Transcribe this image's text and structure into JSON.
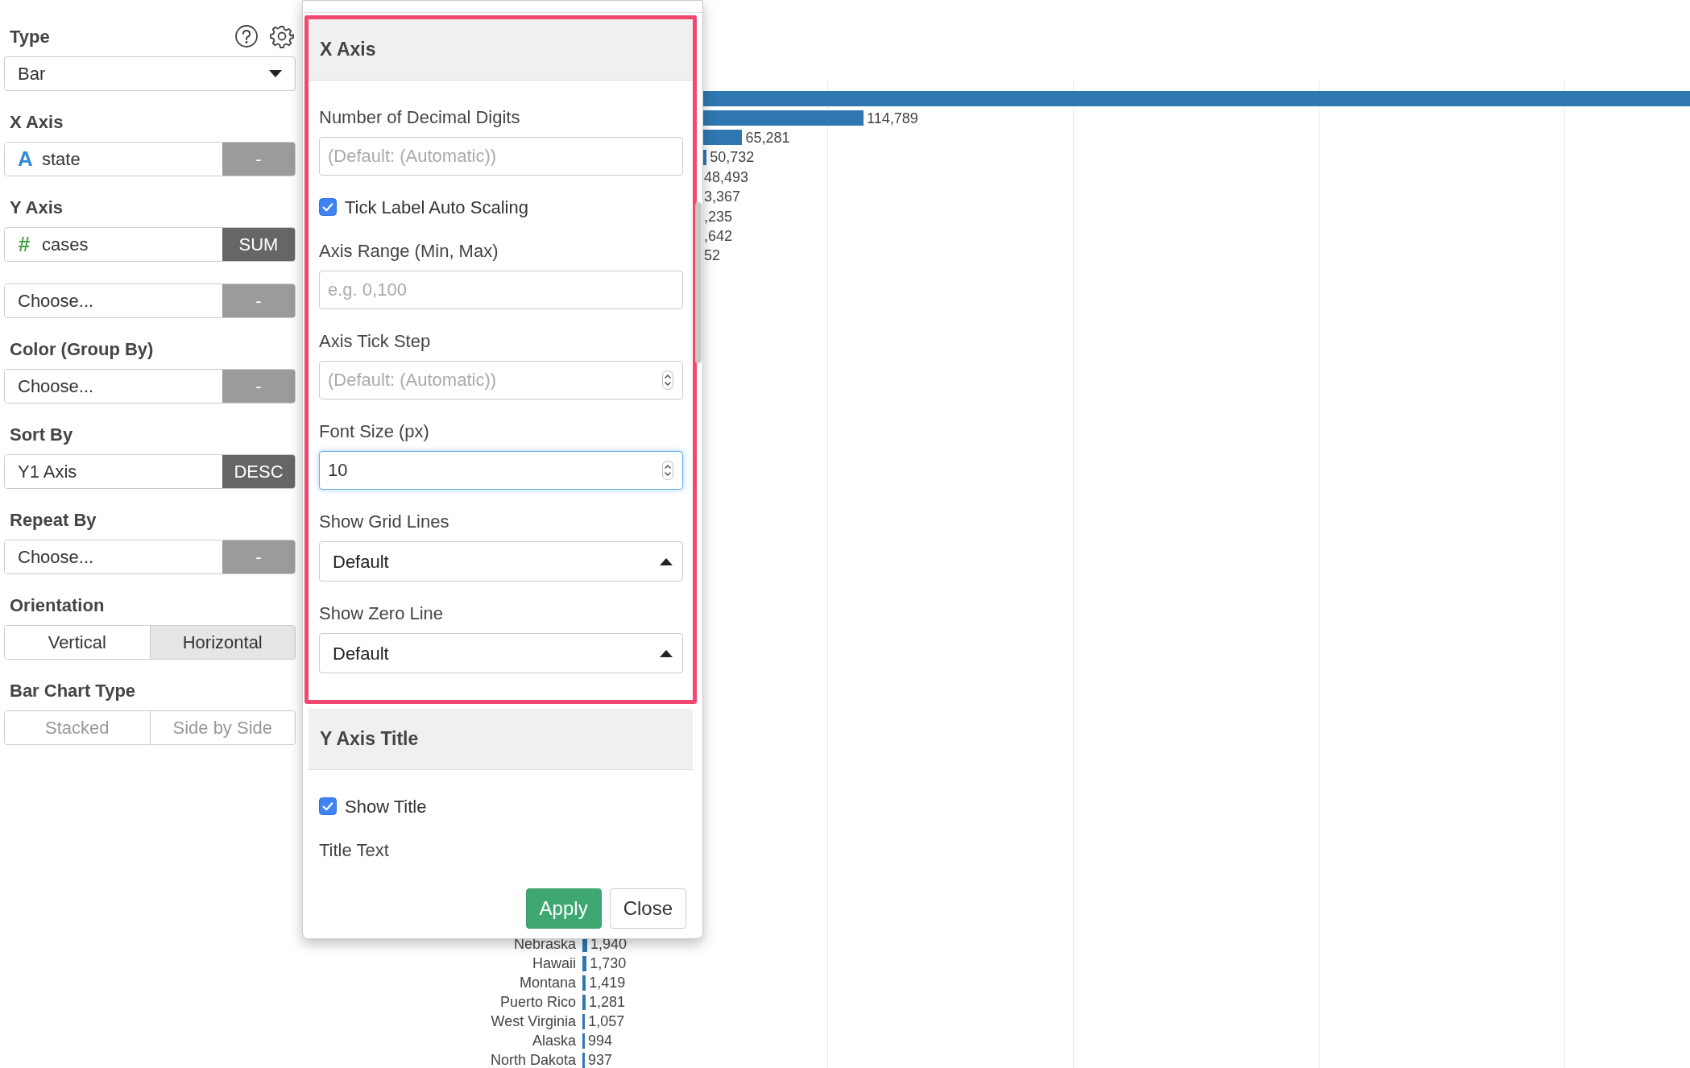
{
  "sidebar": {
    "type": {
      "label": "Type",
      "value": "Bar"
    },
    "sections": [
      {
        "label": "X Axis",
        "controls": [
          {
            "kind": "field",
            "type_mark": {
              "text": "A",
              "color": "#2f8bd6"
            },
            "value": "state",
            "button": {
              "label": "-",
              "active": false
            }
          }
        ]
      },
      {
        "label": "Y Axis",
        "controls": [
          {
            "kind": "field",
            "type_mark": {
              "text": "#",
              "color": "#4aa344"
            },
            "value": "cases",
            "button": {
              "label": "SUM",
              "active": true
            }
          },
          {
            "kind": "field",
            "value": "Choose...",
            "button": {
              "label": "-",
              "active": false
            }
          }
        ]
      },
      {
        "label": "Color (Group By)",
        "controls": [
          {
            "kind": "field",
            "value": "Choose...",
            "button": {
              "label": "-",
              "active": false
            }
          }
        ]
      },
      {
        "label": "Sort By",
        "controls": [
          {
            "kind": "field",
            "value": "Y1 Axis",
            "button": {
              "label": "DESC",
              "active": true
            }
          }
        ]
      },
      {
        "label": "Repeat By",
        "controls": [
          {
            "kind": "field",
            "value": "Choose...",
            "button": {
              "label": "-",
              "active": false
            }
          }
        ]
      },
      {
        "label": "Orientation",
        "controls": [
          {
            "kind": "segmented",
            "options": [
              {
                "label": "Vertical",
                "selected": false,
                "disabled": false
              },
              {
                "label": "Horizontal",
                "selected": true,
                "disabled": false
              }
            ]
          }
        ]
      },
      {
        "label": "Bar Chart Type",
        "controls": [
          {
            "kind": "segmented",
            "options": [
              {
                "label": "Stacked",
                "selected": false,
                "disabled": true
              },
              {
                "label": "Side by Side",
                "selected": false,
                "disabled": true
              }
            ]
          }
        ]
      }
    ]
  },
  "dialog": {
    "sections": [
      {
        "title": "X Axis",
        "highlighted": true,
        "controls": [
          {
            "kind": "input",
            "label": "Number of Decimal Digits",
            "placeholder": "(Default: (Automatic))",
            "spinner": false,
            "focused": false
          },
          {
            "kind": "checkbox",
            "label": "Tick Label Auto Scaling",
            "checked": true
          },
          {
            "kind": "input",
            "label": "Axis Range (Min, Max)",
            "placeholder": "e.g. 0,100",
            "spinner": false,
            "focused": false
          },
          {
            "kind": "input",
            "label": "Axis Tick Step",
            "placeholder": "(Default: (Automatic))",
            "spinner": true,
            "focused": false
          },
          {
            "kind": "input",
            "label": "Font Size (px)",
            "value": "10",
            "spinner": true,
            "focused": true
          },
          {
            "kind": "select",
            "label": "Show Grid Lines",
            "value": "Default"
          },
          {
            "kind": "select",
            "label": "Show Zero Line",
            "value": "Default"
          }
        ]
      },
      {
        "title": "Y Axis Title",
        "highlighted": false,
        "controls": [
          {
            "kind": "checkbox",
            "label": "Show Title",
            "checked": true
          },
          {
            "kind": "label",
            "label": "Title Text"
          }
        ]
      }
    ],
    "buttons": [
      {
        "label": "Apply",
        "kind": "primary"
      },
      {
        "label": "Close",
        "kind": "default"
      }
    ]
  },
  "chart": {
    "top_rows": [
      {
        "kind": "long_bar"
      },
      {
        "kind": "bar",
        "value_label": "114,789"
      },
      {
        "kind": "bar",
        "value_label": "65,281"
      },
      {
        "kind": "bar",
        "value_label": "50,732"
      },
      {
        "kind": "label",
        "value_label": "48,493"
      },
      {
        "kind": "label",
        "value_label": "3,367"
      },
      {
        "kind": "label",
        "value_label": ",235"
      },
      {
        "kind": "label",
        "value_label": ",642"
      },
      {
        "kind": "label",
        "value_label": "52"
      }
    ],
    "bottom_rows": [
      {
        "category": "Nebraska",
        "value_label": "1,940"
      },
      {
        "category": "Hawaii",
        "value_label": "1,730"
      },
      {
        "category": "Montana",
        "value_label": "1,419"
      },
      {
        "category": "Puerto Rico",
        "value_label": "1,281"
      },
      {
        "category": "West Virginia",
        "value_label": "1,057"
      },
      {
        "category": "Alaska",
        "value_label": "994"
      },
      {
        "category": "North Dakota",
        "value_label": "937"
      }
    ]
  }
}
